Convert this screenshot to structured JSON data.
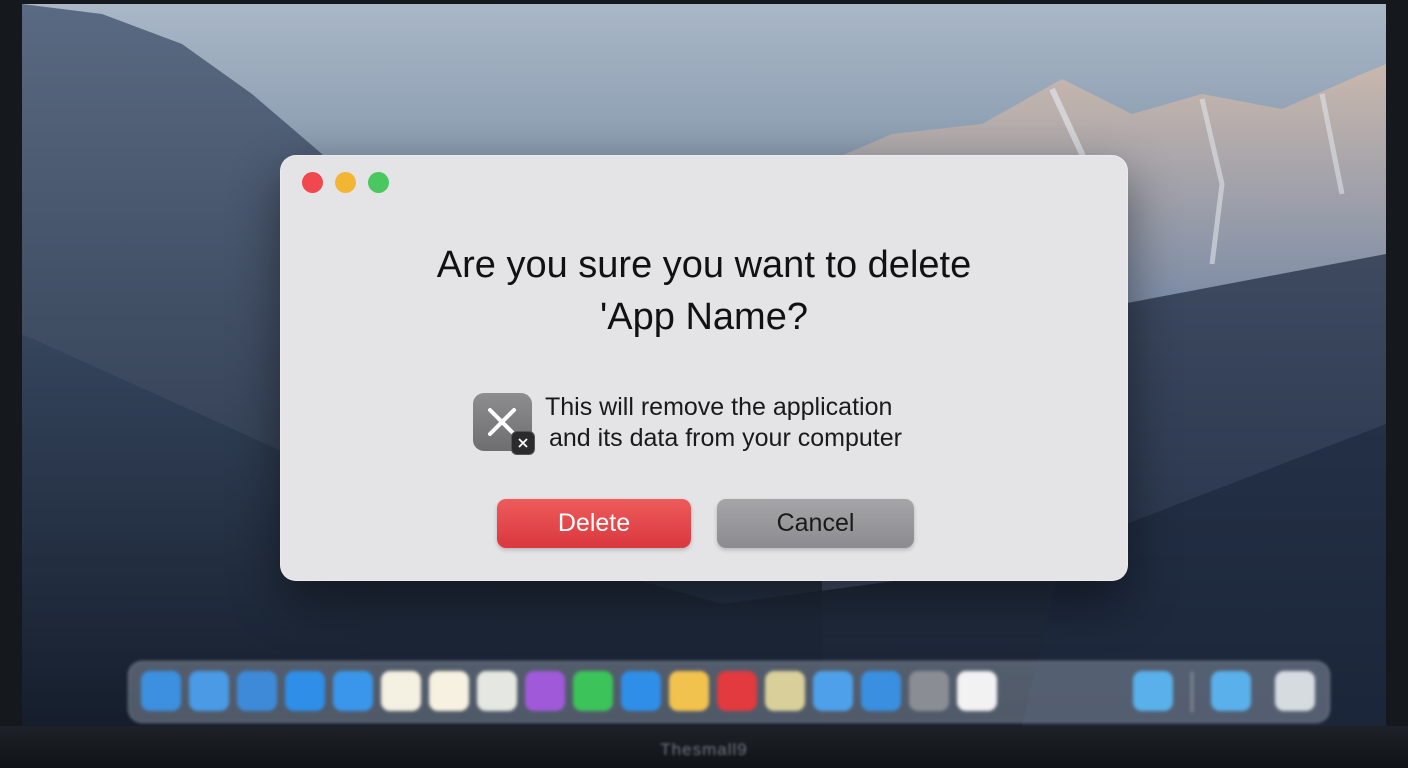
{
  "window": {
    "controls": [
      "close-button",
      "minimize-button",
      "zoom-button"
    ]
  },
  "dialog": {
    "title_line1": "Are you sure you want to delete",
    "title_line2": "'App Name?",
    "message_line1": "This will remove the application",
    "message_line2": "and its data from your computer",
    "delete_label": "Delete",
    "cancel_label": "Cancel",
    "icon": "app-delete-icon"
  },
  "laptop": {
    "brand_text": "Thesmall9"
  },
  "colors": {
    "delete_button": "#e2474b",
    "cancel_button": "#9a9a9d",
    "dialog_background": "#e4e4e7",
    "close_light": "#f0484e",
    "minimize_light": "#f3b534",
    "zoom_light": "#4ac75e"
  },
  "dock": {
    "items": [
      {
        "name": "finder-icon",
        "color": "#3d8fe0"
      },
      {
        "name": "finder-icon-2",
        "color": "#4a9ae6"
      },
      {
        "name": "safari-icon",
        "color": "#3e8ad8"
      },
      {
        "name": "app-store-icon",
        "color": "#2f8ee8"
      },
      {
        "name": "app-store-icon-2",
        "color": "#3a96ea"
      },
      {
        "name": "notes-icon",
        "color": "#f4f0e2"
      },
      {
        "name": "notes-icon-2",
        "color": "#f6f1e0"
      },
      {
        "name": "maps-icon",
        "color": "#e5e8e2"
      },
      {
        "name": "podcasts-icon",
        "color": "#a05ad9"
      },
      {
        "name": "facetime-icon",
        "color": "#3cc45a"
      },
      {
        "name": "app-store-icon-3",
        "color": "#2f8ee8"
      },
      {
        "name": "photos-icon",
        "color": "#f2c24e"
      },
      {
        "name": "news-icon",
        "color": "#e23a3f"
      },
      {
        "name": "preview-icon",
        "color": "#d9cf9a"
      },
      {
        "name": "app-store-icon-4",
        "color": "#4ea0ea"
      },
      {
        "name": "xcode-icon",
        "color": "#3a8fe0"
      },
      {
        "name": "system-settings-icon",
        "color": "#8a8e94"
      },
      {
        "name": "document-icon",
        "color": "#f2f2f2"
      }
    ],
    "right_items": [
      {
        "name": "folder-icon",
        "color": "#5ab0ea"
      },
      {
        "name": "downloads-folder-icon",
        "color": "#5ab0ea"
      },
      {
        "name": "trash-icon",
        "color": "#d6dbe0"
      }
    ]
  }
}
